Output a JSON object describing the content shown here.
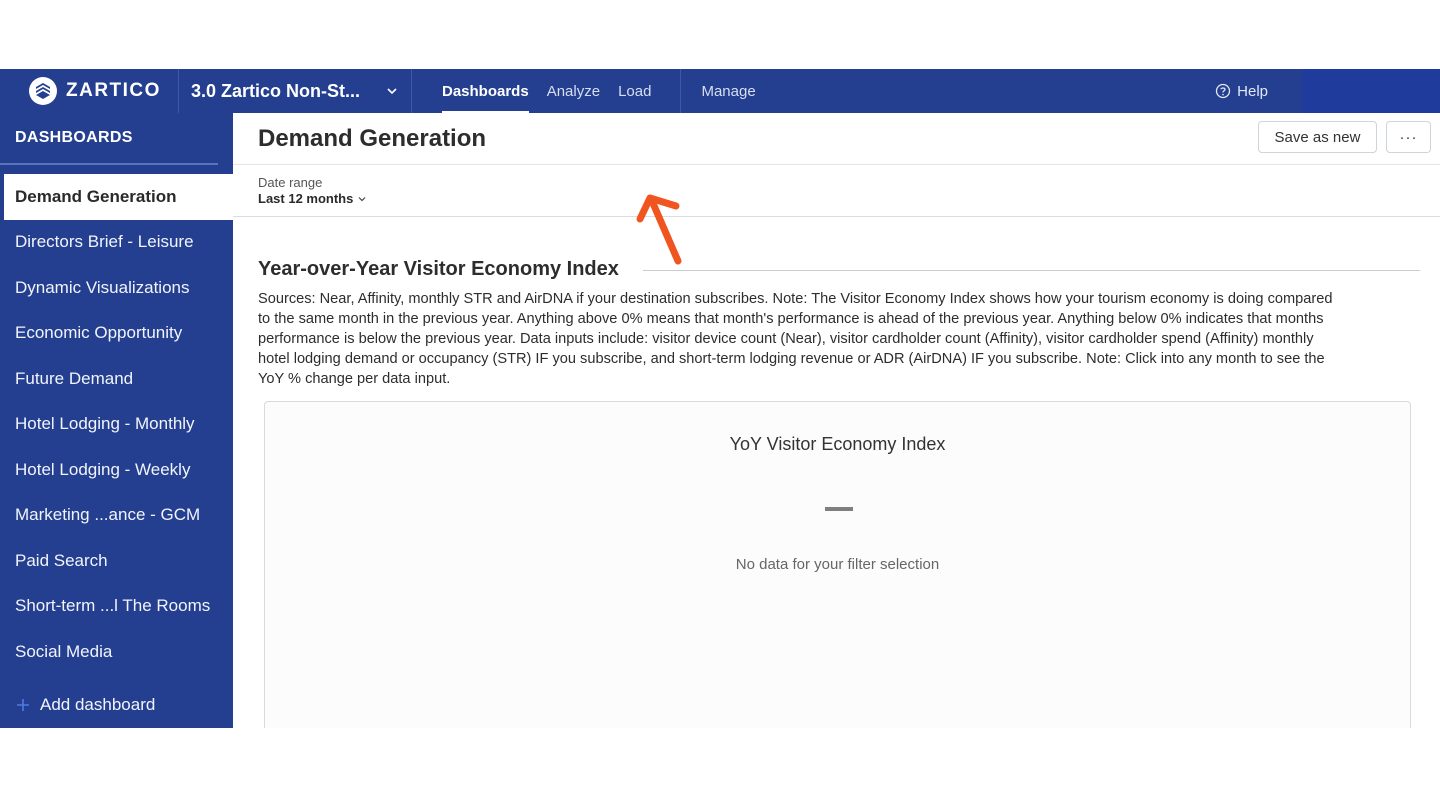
{
  "topbar": {
    "brand": "ZARTICO",
    "workspace": "3.0 Zartico Non-St...",
    "nav": [
      "Dashboards",
      "Analyze",
      "Load"
    ],
    "manage": "Manage",
    "help": "Help"
  },
  "sidebar": {
    "title": "DASHBOARDS",
    "items": [
      {
        "label": "Demand Generation",
        "active": true
      },
      {
        "label": "Directors Brief - Leisure"
      },
      {
        "label": "Dynamic Visualizations"
      },
      {
        "label": "Economic Opportunity"
      },
      {
        "label": "Future Demand"
      },
      {
        "label": "Hotel Lodging - Monthly"
      },
      {
        "label": "Hotel Lodging - Weekly"
      },
      {
        "label": "Marketing ...ance - GCM"
      },
      {
        "label": "Paid Search"
      },
      {
        "label": "Short-term ...l The Rooms"
      },
      {
        "label": "Social Media"
      }
    ],
    "add_label": "Add dashboard"
  },
  "main": {
    "title": "Demand Generation",
    "save_label": "Save as new",
    "more_label": "···",
    "filter": {
      "label": "Date range",
      "value": "Last 12 months"
    },
    "section": {
      "title": "Year-over-Year Visitor Economy Index",
      "description": "Sources: Near, Affinity, monthly STR and AirDNA if your destination subscribes. Note: The Visitor Economy Index shows how your tourism economy is doing compared to the same month in the previous year. Anything above 0% means that month's performance is ahead of the previous year. Anything below 0% indicates that months performance is below the previous year. Data inputs include: visitor device count (Near), visitor cardholder count (Affinity), visitor cardholder spend (Affinity) monthly hotel lodging demand or occupancy (STR) IF you subscribe, and short-term lodging revenue or ADR (AirDNA) IF you subscribe. Note: Click into any month to see the YoY % change per data input."
    },
    "card": {
      "title": "YoY Visitor Economy Index",
      "empty_text": "No data for your filter selection"
    }
  },
  "colors": {
    "brand_navy": "#243f8f",
    "annotation_arrow": "#f0551f"
  }
}
